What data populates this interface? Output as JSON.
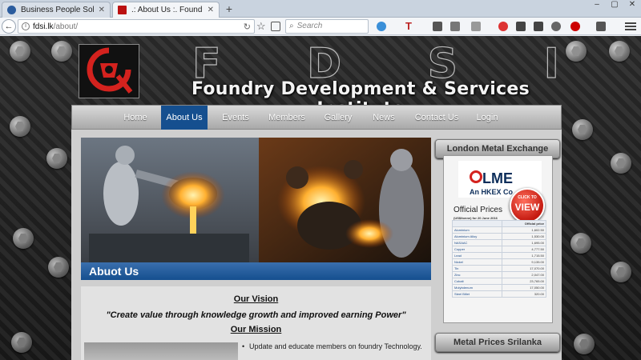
{
  "browser": {
    "tabs": [
      {
        "title": "Business People Solutions"
      },
      {
        "title": ".: About Us :. Foundry Deve..."
      }
    ],
    "url_host": "fdsi.lk",
    "url_path": "/about/",
    "search_placeholder": "Search"
  },
  "header": {
    "logo_letters": [
      "F",
      "D",
      "S",
      "I"
    ],
    "site_title": "Foundry Development & Services Institute"
  },
  "menu": {
    "items": [
      {
        "label": "Home"
      },
      {
        "label": "About Us"
      },
      {
        "label": "Events"
      },
      {
        "label": "Members"
      },
      {
        "label": "Gallery"
      },
      {
        "label": "News"
      },
      {
        "label": "Contact Us"
      },
      {
        "label": "Login"
      }
    ],
    "active_index": 1
  },
  "main": {
    "about_title": "Abuot Us",
    "vision_heading": "Our Vision",
    "vision_text": "\"Create value through knowledge growth and improved earning Power\"",
    "mission_heading": "Our Mission",
    "mission_items": [
      "Update and educate members on foundry Technology."
    ]
  },
  "sidebar": {
    "lme_heading": "London Metal Exchange",
    "lme_logo": "LME",
    "lme_sub": "An HKEX Co",
    "lme_badge_small": "CLICK TO",
    "lme_badge_big": "VIEW",
    "official_title": "Official Prices",
    "price_caption": "(US$/tonne) for 20 June 2016",
    "price_header": "Official price",
    "prices": [
      {
        "metal": "Aluminium",
        "price": "1,602.50"
      },
      {
        "metal": "Aluminium Alloy",
        "price": "1,530.00"
      },
      {
        "metal": "NASAAC",
        "price": "1,695.00"
      },
      {
        "metal": "Copper",
        "price": "4,777.50"
      },
      {
        "metal": "Lead",
        "price": "1,715.50"
      },
      {
        "metal": "Nickel",
        "price": "9,135.00"
      },
      {
        "metal": "Tin",
        "price": "17,070.00"
      },
      {
        "metal": "Zinc",
        "price": "2,047.00"
      },
      {
        "metal": "Cobalt",
        "price": "23,765.00"
      },
      {
        "metal": "Molybdenum",
        "price": "17,050.00"
      },
      {
        "metal": "Steel Billet",
        "price": "320.00"
      }
    ],
    "srilanka_heading": "Metal Prices Srilanka"
  },
  "colors": {
    "menu_active": "#154f8f",
    "lme_red": "#d4221e",
    "lme_navy": "#0c2d5a"
  }
}
